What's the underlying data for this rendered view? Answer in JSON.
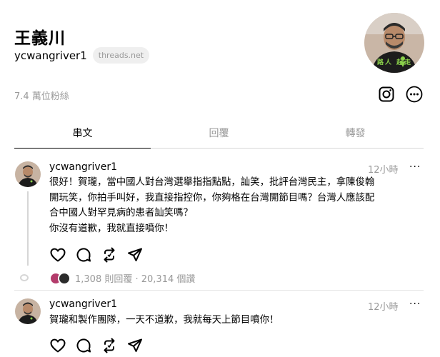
{
  "profile": {
    "name": "王義川",
    "handle": "ycwangriver1",
    "domain_badge": "threads.net",
    "followers": "7.4 萬位粉絲",
    "avatar_shirt_text": "路人 起走"
  },
  "tabs": [
    {
      "label": "串文",
      "active": true
    },
    {
      "label": "回覆",
      "active": false
    },
    {
      "label": "轉發",
      "active": false
    }
  ],
  "posts": [
    {
      "user": "ycwangriver1",
      "time": "12小時",
      "more": "···",
      "lines": [
        "很好！賀瓏，當中國人對台灣選舉指指點點，訕笑，批評台灣民主，拿陳俊翰",
        "開玩笑，你拍手叫好，我直接指控你，你夠格在台灣開節目嗎？台灣人應該配",
        "合中國人對罕見病的患者訕笑嗎？",
        "你沒有道歉，我就直接噴你！"
      ],
      "stats": "1,308 則回覆 · 20,314 個讚"
    },
    {
      "user": "ycwangriver1",
      "time": "12小時",
      "more": "···",
      "lines": [
        "賀瓏和製作團隊，一天不道歉，我就每天上節目噴你！"
      ]
    }
  ],
  "colors": {
    "muted": "#999999",
    "divider": "#d6d6d6",
    "shirt": "#1c1c1c",
    "shirt_print": "#8bd14b"
  },
  "icons": [
    "instagram-icon",
    "more-circle-icon",
    "heart-icon",
    "comment-icon",
    "repost-icon",
    "share-icon"
  ]
}
